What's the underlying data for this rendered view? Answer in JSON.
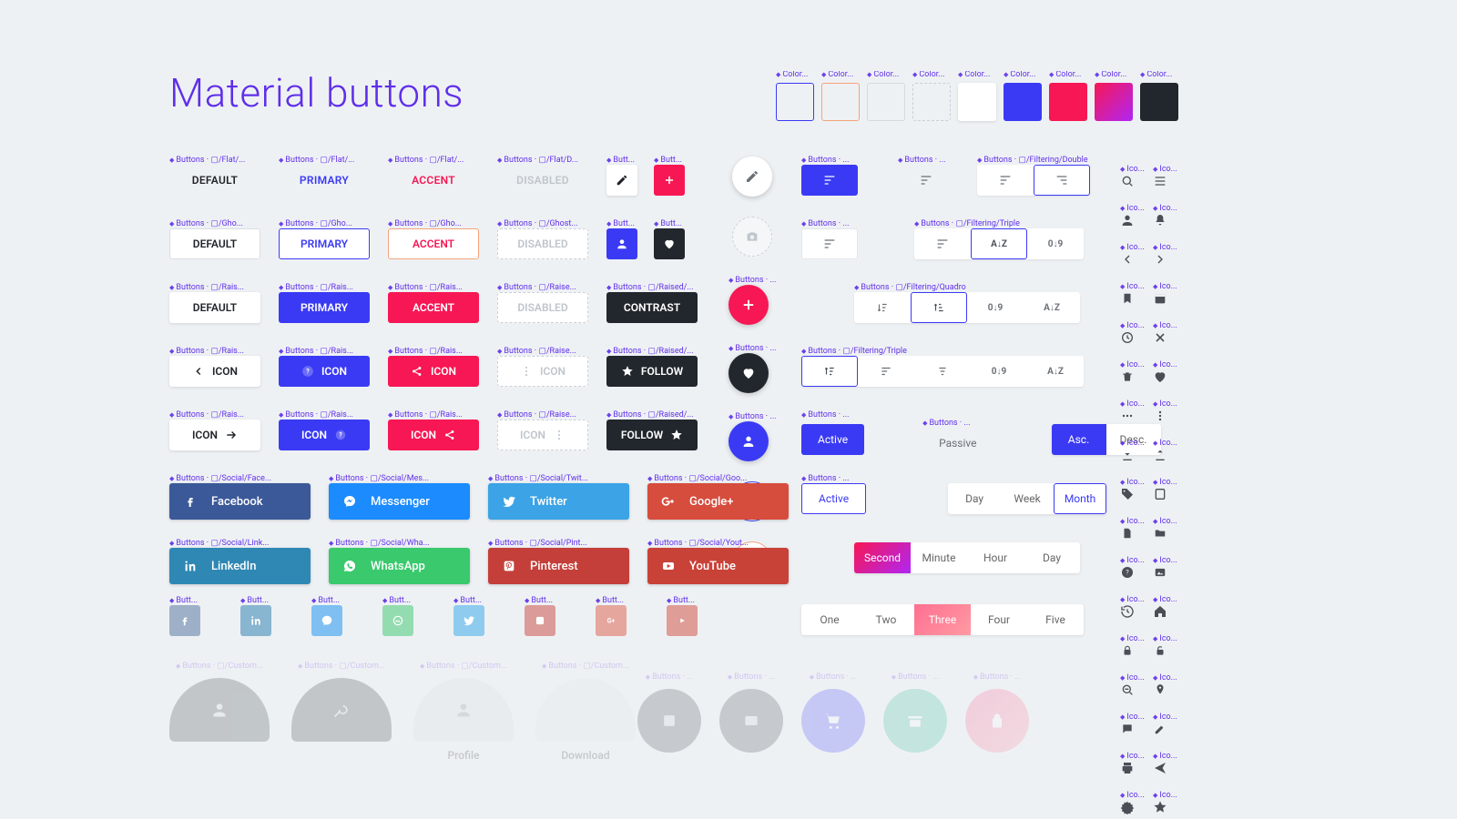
{
  "title": "Material buttons",
  "colors": {
    "primary": "#3A3AF4",
    "accent": "#F71754",
    "disabled": "#BFC5CC",
    "contrast": "#22272D",
    "gradient_a": "#F71754",
    "gradient_b": "#B026F5"
  },
  "tags": {
    "color": "Color...",
    "flat": "Buttons · ▢/Flat/...",
    "flatd": "Buttons · ▢/Flat/D...",
    "gho": "Buttons · ▢/Gho...",
    "ghostd": "Buttons · ▢/Ghost...",
    "rais": "Buttons · ▢/Rais...",
    "raise": "Buttons · ▢/Raise...",
    "raised": "Buttons · ▢/Raised/...",
    "butt": "Butt...",
    "buttons": "Buttons · ...",
    "filt_double": "Buttons · ▢/Filtering/Double",
    "filt_triple": "Buttons · ▢/Filtering/Triple",
    "filt_quadro": "Buttons · ▢/Filtering/Quadro",
    "ico": "Ico...",
    "soc_fb": "Buttons · ▢/Social/Face...",
    "soc_ms": "Buttons · ▢/Social/Mes...",
    "soc_tw": "Buttons · ▢/Social/Twit...",
    "soc_gp": "Buttons · ▢/Social/Goo...",
    "soc_li": "Buttons · ▢/Social/Link...",
    "soc_wa": "Buttons · ▢/Social/Wha...",
    "soc_pn": "Buttons · ▢/Social/Pint...",
    "soc_yt": "Buttons · ▢/Social/Yout...",
    "custom": "Buttons · ▢/Custom..."
  },
  "flat": {
    "default": "DEFAULT",
    "primary": "PRIMARY",
    "accent": "ACCENT",
    "disabled": "DISABLED"
  },
  "ghost": {
    "default": "DEFAULT",
    "primary": "PRIMARY",
    "accent": "ACCENT",
    "disabled": "DISABLED"
  },
  "raised": {
    "default": "DEFAULT",
    "primary": "PRIMARY",
    "accent": "ACCENT",
    "disabled": "DISABLED",
    "contrast": "CONTRAST"
  },
  "iconbtn": {
    "icon": "ICON",
    "follow": "FOLLOW"
  },
  "social": {
    "fb": "Facebook",
    "ms": "Messenger",
    "tw": "Twitter",
    "gp": "Google+",
    "li": "LinkedIn",
    "wa": "WhatsApp",
    "pn": "Pinterest",
    "yt": "YouTube"
  },
  "chips": {
    "active": "Active",
    "passive": "Passive",
    "asc": "Asc.",
    "desc": "Desc."
  },
  "seg1": {
    "a": "Day",
    "b": "Week",
    "c": "Month"
  },
  "seg2": {
    "a": "Second",
    "b": "Minute",
    "c": "Hour",
    "d": "Day"
  },
  "seg3": {
    "a": "One",
    "b": "Two",
    "c": "Three",
    "d": "Four",
    "e": "Five"
  },
  "ghostbtn": {
    "profile": "Profile",
    "download": "Download"
  }
}
